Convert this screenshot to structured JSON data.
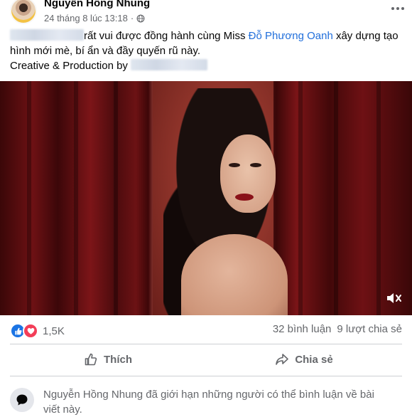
{
  "post": {
    "author": "Nguyễn Hồng Nhung",
    "timestamp": "24 tháng 8 lúc 13:18",
    "separator": "·",
    "audience_icon": "globe-icon",
    "more_icon": "more-horizontal-icon"
  },
  "caption": {
    "line1_text": "rất vui được đồng hành cùng Miss ",
    "line1_link": "Đỗ Phương Oanh",
    "line1_rest": " xây dựng tạo hình mới mè, bí ẩn và đầy quyến rũ này.",
    "line2_prefix": "Creative & Production by "
  },
  "media": {
    "mute_icon": "volume-muted-icon"
  },
  "stats": {
    "reaction_icons": [
      "like-reaction-icon",
      "love-reaction-icon"
    ],
    "reaction_count": "1,5K",
    "comments": "32 bình luận",
    "shares": "9 lượt chia sẻ"
  },
  "actions": {
    "like_label": "Thích",
    "share_label": "Chia sẻ"
  },
  "notice": {
    "text": "Nguyễn Hồng Nhung đã giới hạn những người có thể bình luận về bài viết này.",
    "icon": "comment-bubble-icon"
  },
  "colors": {
    "link": "#216fdb",
    "like": "#1b74e4",
    "love": "#f33e58",
    "secondary_text": "#65676b"
  }
}
